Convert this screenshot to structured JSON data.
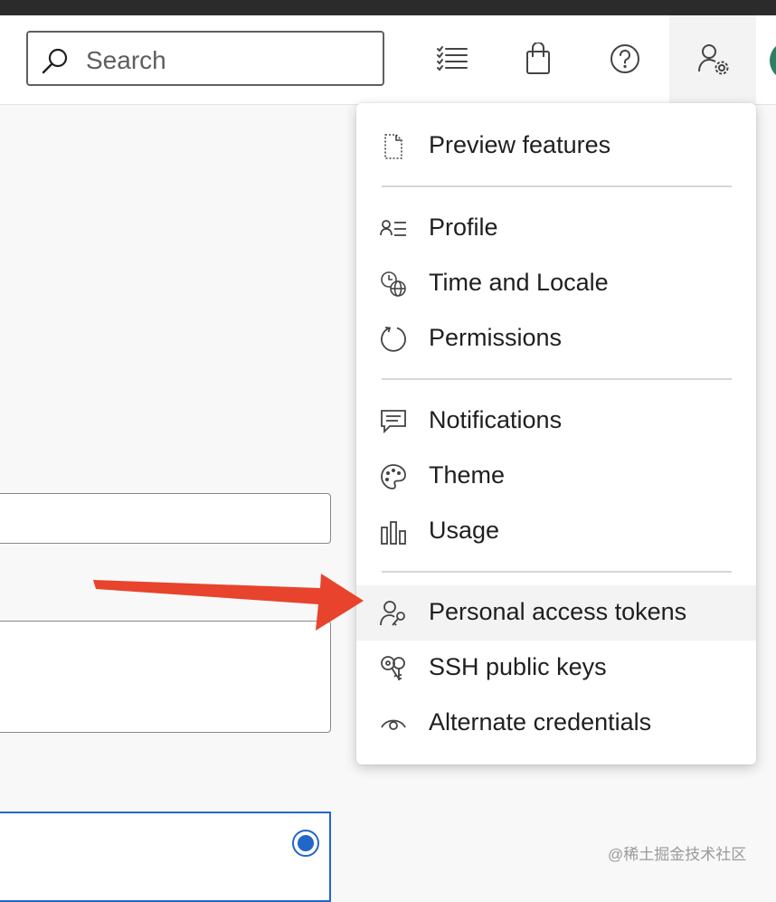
{
  "header": {
    "search": {
      "placeholder": "Search"
    },
    "buttons": [
      {
        "name": "work-items-icon"
      },
      {
        "name": "marketplace-bag-icon"
      },
      {
        "name": "help-icon"
      },
      {
        "name": "user-settings-icon"
      }
    ]
  },
  "user_menu": {
    "groups": [
      {
        "items": [
          {
            "label": "Preview features",
            "icon": "preview-page-icon"
          }
        ]
      },
      {
        "items": [
          {
            "label": "Profile",
            "icon": "profile-icon"
          },
          {
            "label": "Time and Locale",
            "icon": "time-locale-icon"
          },
          {
            "label": "Permissions",
            "icon": "permissions-icon"
          }
        ]
      },
      {
        "items": [
          {
            "label": "Notifications",
            "icon": "notifications-icon"
          },
          {
            "label": "Theme",
            "icon": "palette-icon"
          },
          {
            "label": "Usage",
            "icon": "usage-chart-icon"
          }
        ]
      },
      {
        "items": [
          {
            "label": "Personal access tokens",
            "icon": "person-key-icon",
            "highlighted": true
          },
          {
            "label": "SSH public keys",
            "icon": "keys-icon"
          },
          {
            "label": "Alternate credentials",
            "icon": "eye-icon"
          }
        ]
      }
    ]
  },
  "annotation": {
    "arrow_color": "#e8432c"
  },
  "watermark": "@稀土掘金技术社区",
  "colors": {
    "accent": "#2266c8",
    "avatar": "#2f7d62"
  }
}
